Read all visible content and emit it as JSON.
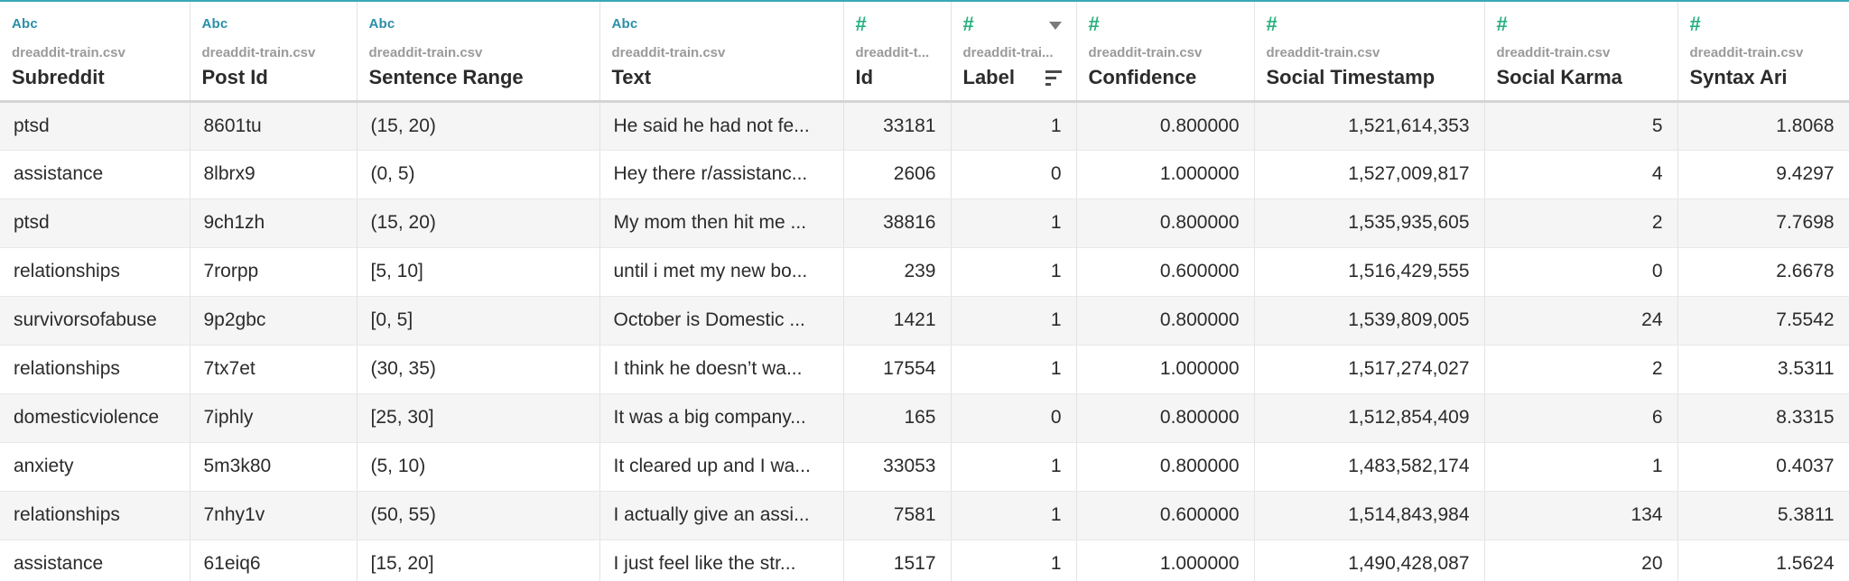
{
  "columns": [
    {
      "type": "string",
      "type_label": "Abc",
      "source": "dreaddit-train.csv",
      "name": "Subreddit",
      "align": "left"
    },
    {
      "type": "string",
      "type_label": "Abc",
      "source": "dreaddit-train.csv",
      "name": "Post Id",
      "align": "left"
    },
    {
      "type": "string",
      "type_label": "Abc",
      "source": "dreaddit-train.csv",
      "name": "Sentence Range",
      "align": "left"
    },
    {
      "type": "string",
      "type_label": "Abc",
      "source": "dreaddit-train.csv",
      "name": "Text",
      "align": "left"
    },
    {
      "type": "number",
      "type_label": "#",
      "source": "dreaddit-t...",
      "name": "Id",
      "align": "right"
    },
    {
      "type": "number",
      "type_label": "#",
      "source": "dreaddit-trai...",
      "name": "Label",
      "align": "right",
      "sorted": true
    },
    {
      "type": "number",
      "type_label": "#",
      "source": "dreaddit-train.csv",
      "name": "Confidence",
      "align": "right"
    },
    {
      "type": "number",
      "type_label": "#",
      "source": "dreaddit-train.csv",
      "name": "Social Timestamp",
      "align": "right"
    },
    {
      "type": "number",
      "type_label": "#",
      "source": "dreaddit-train.csv",
      "name": "Social Karma",
      "align": "right"
    },
    {
      "type": "number",
      "type_label": "#",
      "source": "dreaddit-train.csv",
      "name": "Syntax Ari",
      "align": "right"
    }
  ],
  "rows": [
    [
      "ptsd",
      "8601tu",
      "(15, 20)",
      "He said he had not fe...",
      "33181",
      "1",
      "0.800000",
      "1,521,614,353",
      "5",
      "1.8068"
    ],
    [
      "assistance",
      "8lbrx9",
      "(0, 5)",
      "Hey there r/assistanc...",
      "2606",
      "0",
      "1.000000",
      "1,527,009,817",
      "4",
      "9.4297"
    ],
    [
      "ptsd",
      "9ch1zh",
      "(15, 20)",
      "My mom then hit me ...",
      "38816",
      "1",
      "0.800000",
      "1,535,935,605",
      "2",
      "7.7698"
    ],
    [
      "relationships",
      "7rorpp",
      "[5, 10]",
      "until i met my new bo...",
      "239",
      "1",
      "0.600000",
      "1,516,429,555",
      "0",
      "2.6678"
    ],
    [
      "survivorsofabuse",
      "9p2gbc",
      "[0, 5]",
      "October is Domestic ...",
      "1421",
      "1",
      "0.800000",
      "1,539,809,005",
      "24",
      "7.5542"
    ],
    [
      "relationships",
      "7tx7et",
      "(30, 35)",
      "I think he doesn’t wa...",
      "17554",
      "1",
      "1.000000",
      "1,517,274,027",
      "2",
      "3.5311"
    ],
    [
      "domesticviolence",
      "7iphly",
      "[25, 30]",
      "It was a big company...",
      "165",
      "0",
      "0.800000",
      "1,512,854,409",
      "6",
      "8.3315"
    ],
    [
      "anxiety",
      "5m3k80",
      "(5, 10)",
      "It cleared up and I wa...",
      "33053",
      "1",
      "0.800000",
      "1,483,582,174",
      "1",
      "0.4037"
    ],
    [
      "relationships",
      "7nhy1v",
      "(50, 55)",
      "I actually give an assi...",
      "7581",
      "1",
      "0.600000",
      "1,514,843,984",
      "134",
      "5.3811"
    ],
    [
      "assistance",
      "61eiq6",
      "[15, 20]",
      "I just feel like the str...",
      "1517",
      "1",
      "1.000000",
      "1,490,428,087",
      "20",
      "1.5624"
    ]
  ],
  "colors": {
    "string_type": "#2a8fa8",
    "number_type": "#27b07e",
    "accent_top": "#3aa8b8"
  }
}
